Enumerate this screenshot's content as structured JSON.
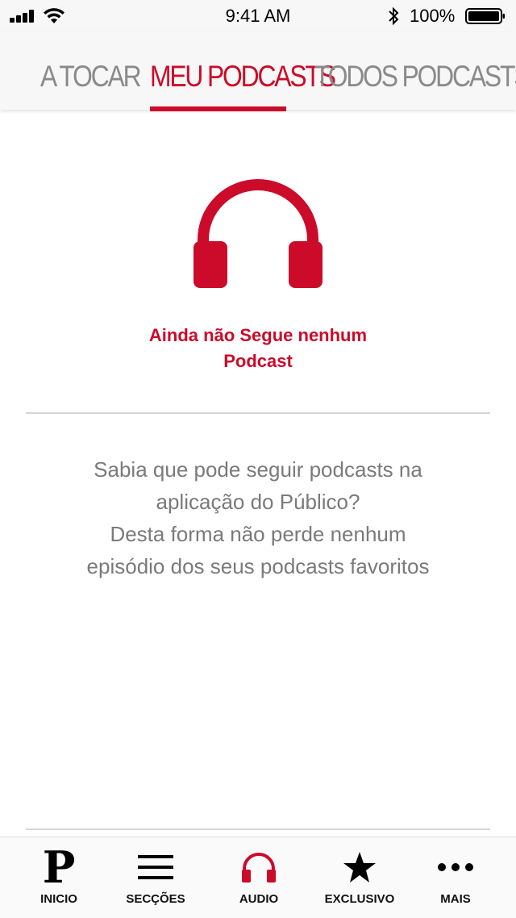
{
  "status_bar": {
    "time": "9:41 AM",
    "battery": "100%"
  },
  "tabs": [
    {
      "label": "A TOCAR",
      "active": false
    },
    {
      "label": "MEU PODCASTS",
      "active": true
    },
    {
      "label": "TODOS PODCASTS",
      "active": false
    }
  ],
  "empty_state": {
    "icon": "headphones-icon",
    "title_line1": "Ainda não Segue nenhum",
    "title_line2": "Podcast"
  },
  "info": {
    "line1": "Sabia que pode seguir podcasts na",
    "line2": "aplicação do Público?",
    "line3": "Desta forma não perde nenhum",
    "line4": "episódio dos seus podcasts favoritos"
  },
  "bottom_nav": [
    {
      "label": "INICIO",
      "icon": "publico-logo-icon"
    },
    {
      "label": "SECÇÕES",
      "icon": "menu-icon"
    },
    {
      "label": "AUDIO",
      "icon": "headphones-icon",
      "active": true
    },
    {
      "label": "EXCLUSIVO",
      "icon": "star-icon"
    },
    {
      "label": "MAIS",
      "icon": "more-icon"
    }
  ],
  "colors": {
    "accent": "#cc0a29",
    "muted_text": "#7a7a7a",
    "inactive_tab": "#8a8a8a"
  }
}
